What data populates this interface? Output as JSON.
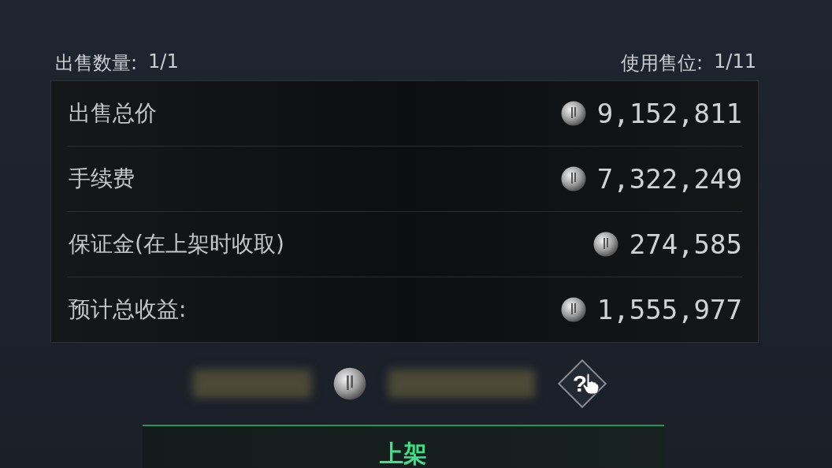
{
  "header": [
    {
      "label": "出售数量:",
      "value": "1/1"
    },
    {
      "label": "使用售位:",
      "value": "1/11"
    }
  ],
  "summary": [
    {
      "label": "出售总价",
      "amount": "9,152,811"
    },
    {
      "label": "手续费",
      "amount": "7,322,249"
    },
    {
      "label": "保证金(在上架时收取)",
      "amount": "274,585"
    },
    {
      "label": "预计总收益:",
      "amount": "1,555,977"
    }
  ],
  "help_button": {
    "label": "?"
  },
  "list_button": {
    "label": "上架"
  }
}
